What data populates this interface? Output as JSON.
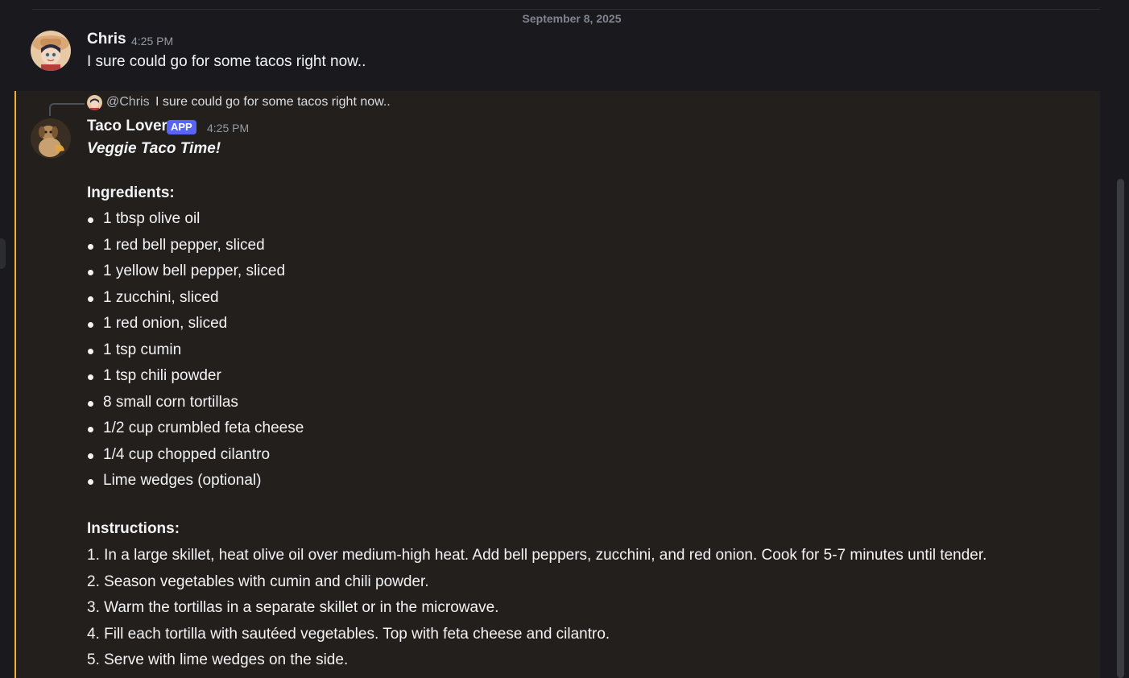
{
  "date_divider": "September 8, 2025",
  "message_1": {
    "author": "Chris",
    "time": "4:25 PM",
    "text": "I sure could go for some tacos right now.."
  },
  "message_2": {
    "reply": {
      "mention": "@Chris",
      "text": "I sure could go for some tacos right now.."
    },
    "author": "Taco Lover",
    "app_tag": "APP",
    "time": "4:25 PM",
    "title": "Veggie Taco Time!",
    "ingredients_heading": "Ingredients:",
    "ingredients": [
      "1 tbsp olive oil",
      "1 red bell pepper, sliced",
      "1 yellow bell pepper, sliced",
      "1 zucchini, sliced",
      "1 red onion, sliced",
      "1 tsp cumin",
      "1 tsp chili powder",
      "8 small corn tortillas",
      "1/2 cup crumbled feta cheese",
      "1/4 cup chopped cilantro",
      "Lime wedges (optional)"
    ],
    "instructions_heading": "Instructions:",
    "instructions": [
      "1. In a large skillet, heat olive oil over medium-high heat. Add bell peppers, zucchini, and red onion. Cook for 5-7 minutes until tender.",
      "2. Season vegetables with cumin and chili powder.",
      "3. Warm the tortillas in a separate skillet or in the microwave.",
      "4. Fill each tortilla with sautéed vegetables. Top with feta cheese and cilantro.",
      "5. Serve with lime wedges on the side."
    ]
  },
  "colors": {
    "background": "#1a1a1e",
    "highlight": "#231f1d",
    "highlight_bar": "#f0b232",
    "app_tag": "#5865f2"
  }
}
